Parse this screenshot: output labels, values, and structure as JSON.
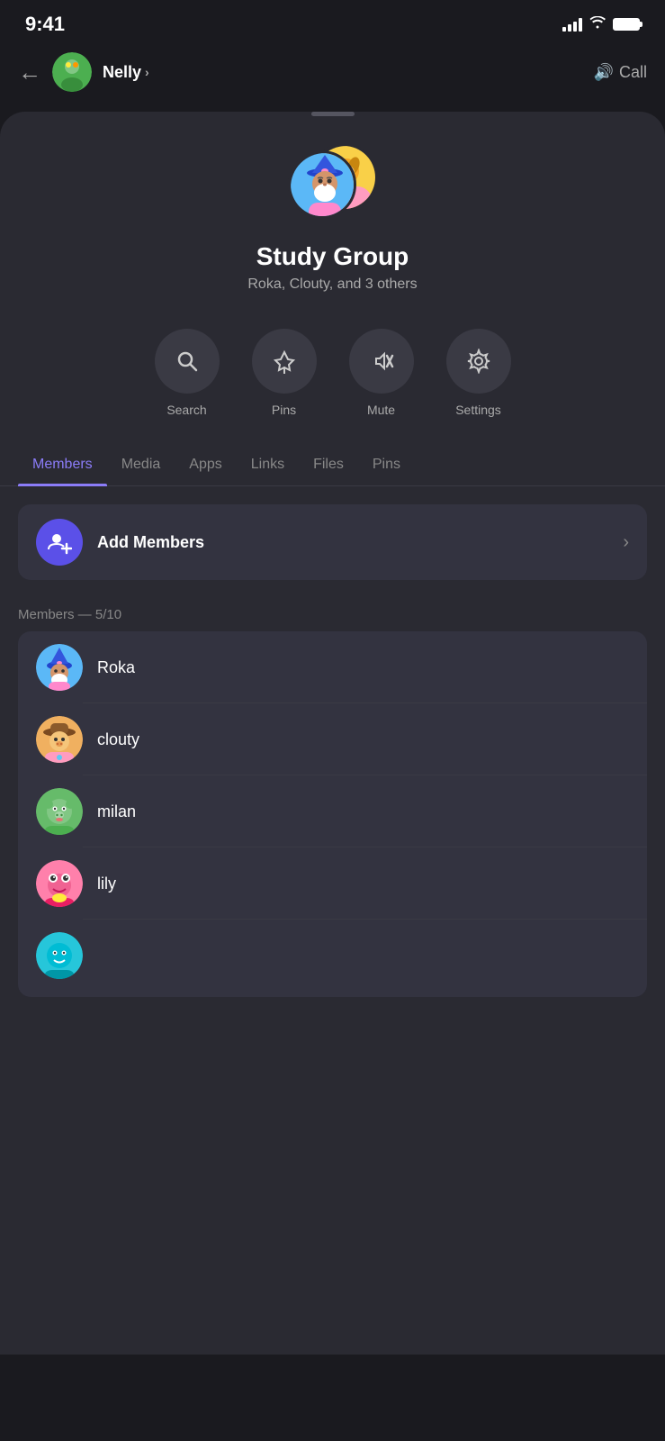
{
  "statusBar": {
    "time": "9:41",
    "battery": "full"
  },
  "header": {
    "backLabel": "←",
    "name": "Nelly",
    "chevron": "›",
    "callLabel": "Call",
    "callIcon": "🔊"
  },
  "sheet": {
    "groupName": "Study Group",
    "groupMembersText": "Roka, Clouty, and 3 others",
    "actions": [
      {
        "id": "search",
        "label": "Search",
        "icon": "🔍"
      },
      {
        "id": "pins",
        "label": "Pins",
        "icon": "📌"
      },
      {
        "id": "mute",
        "label": "Mute",
        "icon": "🔇"
      },
      {
        "id": "settings",
        "label": "Settings",
        "icon": "⚙️"
      }
    ],
    "tabs": [
      {
        "id": "members",
        "label": "Members",
        "active": true
      },
      {
        "id": "media",
        "label": "Media",
        "active": false
      },
      {
        "id": "apps",
        "label": "Apps",
        "active": false
      },
      {
        "id": "links",
        "label": "Links",
        "active": false
      },
      {
        "id": "files",
        "label": "Files",
        "active": false
      },
      {
        "id": "pins",
        "label": "Pins",
        "active": false
      }
    ],
    "addMembersLabel": "Add Members",
    "membersCountLabel": "Members — 5/10",
    "members": [
      {
        "id": "roka",
        "name": "Roka",
        "avatarType": "wizard"
      },
      {
        "id": "clouty",
        "name": "clouty",
        "avatarType": "cowboy"
      },
      {
        "id": "milan",
        "name": "milan",
        "avatarType": "pig"
      },
      {
        "id": "lily",
        "name": "lily",
        "avatarType": "frog"
      },
      {
        "id": "extra",
        "name": "",
        "avatarType": "deer"
      }
    ]
  }
}
